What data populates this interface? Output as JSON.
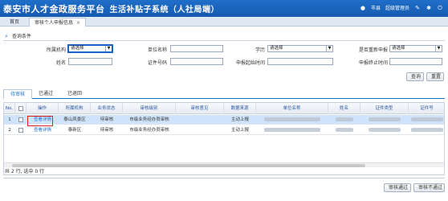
{
  "app": {
    "title": "泰安市人才金政服务平台",
    "subtitle": "生活补贴子系统（人社局端）",
    "user_label": "市县",
    "user_name": "超级管理员"
  },
  "tabs": [
    {
      "label": "首页"
    },
    {
      "label": "审核个人申报信息",
      "close": "×"
    }
  ],
  "section_title": "查询条件",
  "filters": {
    "org_label": "所属机构",
    "org_value": "请选择",
    "unit_label": "单位名称",
    "unit_value": "",
    "edu_label": "学历",
    "edu_value": "请选择",
    "reapply_label": "是否重新申报",
    "reapply_value": "请选择",
    "name_label": "姓名",
    "name_value": "",
    "idno_label": "证件号码",
    "idno_value": "",
    "start_label": "申报起始时间",
    "start_value": "",
    "end_label": "申报终止时间",
    "end_value": ""
  },
  "buttons": {
    "query": "查询",
    "reset": "重置",
    "approve": "审核通过",
    "reject": "审核不通过"
  },
  "subtabs": [
    {
      "label": "待审核"
    },
    {
      "label": "已通过"
    },
    {
      "label": "已退回"
    }
  ],
  "columns": [
    "No.",
    "",
    "操作",
    "所属机构",
    "业务状态",
    "审核级别",
    "审核意见",
    "数据来源",
    "单位名称",
    "姓名",
    "证件类型",
    "证件号"
  ],
  "rows": [
    {
      "no": "1",
      "action": "查看详情",
      "org": "泰山风景区",
      "status": "待审核",
      "level": "市级业务经办员审核",
      "opinion": "",
      "source": "主动上报"
    },
    {
      "no": "2",
      "action": "查看详情",
      "org": "泰新区",
      "status": "待审核",
      "level": "市级业务经办员审核",
      "opinion": "",
      "source": "主动上报"
    }
  ],
  "footer": "共 2 行, 选中 0 行",
  "colors": {
    "primary": "#1f6fc9",
    "selected_row": "#cfe4fb",
    "highlight": "#e02020"
  }
}
